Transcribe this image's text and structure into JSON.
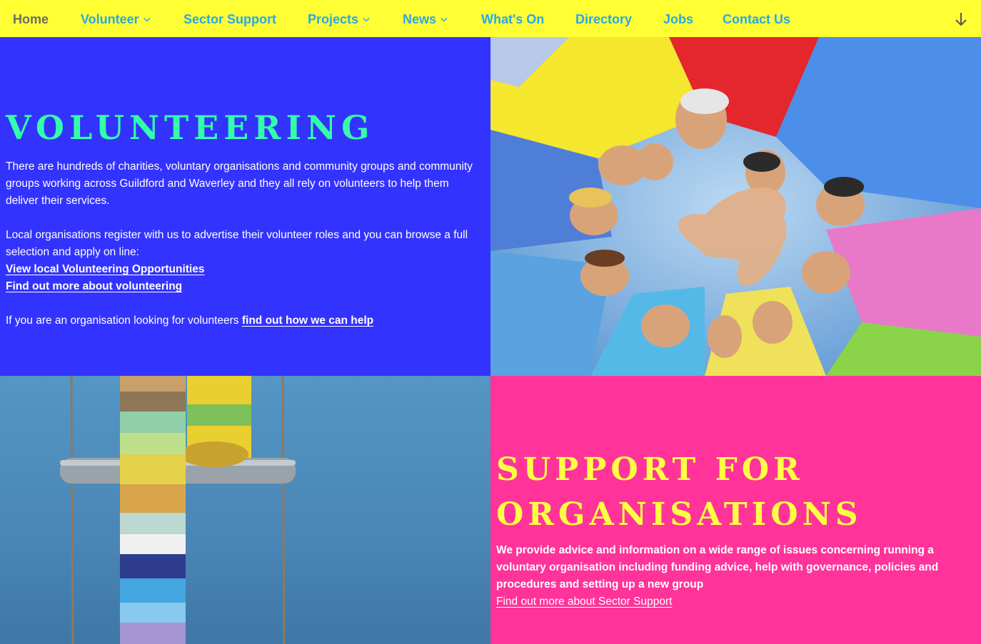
{
  "nav": {
    "home": "Home",
    "volunteer": "Volunteer",
    "sector_support": "Sector Support",
    "projects": "Projects",
    "news": "News",
    "whats_on": "What's On",
    "directory": "Directory",
    "jobs": "Jobs",
    "contact_us": "Contact Us"
  },
  "volunteering": {
    "heading": "VOLUNTEERING",
    "para1": "There are hundreds of charities, voluntary organisations and community groups and community groups working across Guildford and Waverley and they all rely on volunteers to help them deliver their services.",
    "para2": "Local organisations register with us to advertise their volunteer roles and you can browse a full selection and apply on line:",
    "link_opportunities": "View local Volunteering Opportunities",
    "link_find_out": "Find out more about volunteering",
    "org_text": "If you are an organisation looking for volunteers ",
    "org_link": "find out how we can help"
  },
  "support": {
    "heading": "SUPPORT FOR ORGANISATIONS",
    "para": "We provide advice and information on a wide range of issues concerning running a voluntary organisation including funding advice, help with governance, policies and procedures and setting up a new group",
    "link": "Find out more about Sector Support"
  },
  "icons": {
    "dropdown": "chevron-down-icon",
    "scroll": "arrow-down-icon"
  },
  "colors": {
    "nav_bg": "#ffff33",
    "nav_link": "#29a8e6",
    "volunteer_bg": "#3333ff",
    "volunteer_heading": "#33ffaa",
    "support_bg": "#ff3399",
    "support_heading": "#ffff44"
  }
}
